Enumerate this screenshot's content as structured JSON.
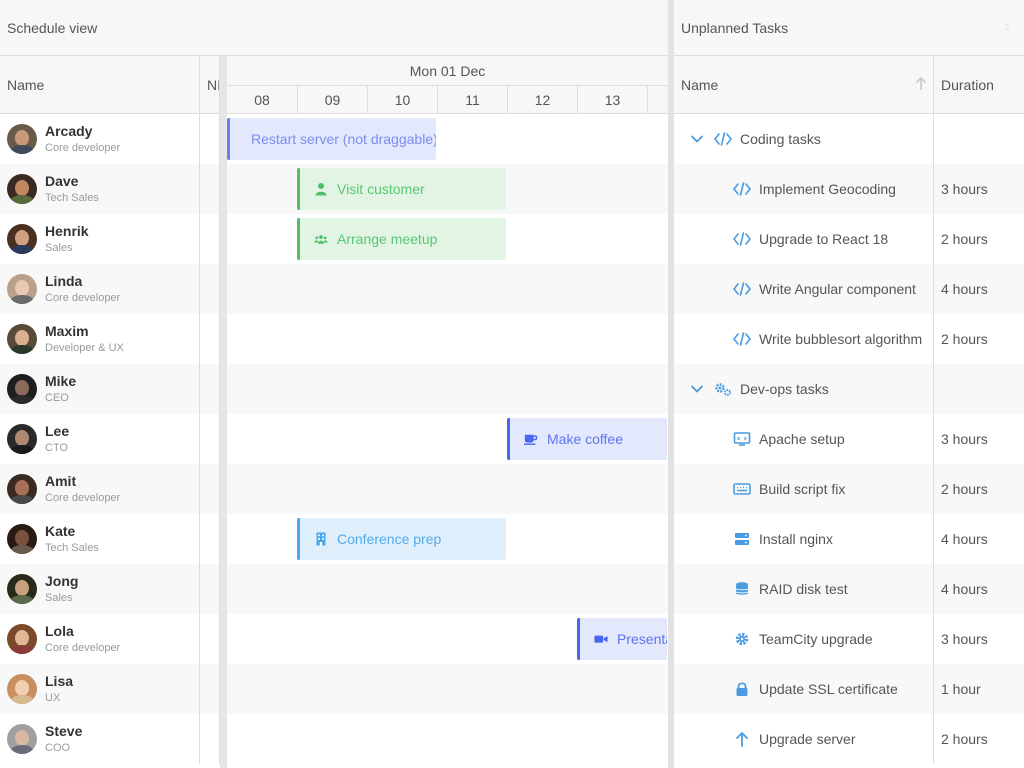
{
  "schedule": {
    "title": "Schedule view",
    "resource_column": "Name",
    "nl_column": "NI",
    "date": "Mon 01 Dec",
    "hours": [
      "08",
      "09",
      "10",
      "11",
      "12",
      "13"
    ],
    "resources": [
      {
        "name": "Arcady",
        "role": "Core developer"
      },
      {
        "name": "Dave",
        "role": "Tech Sales"
      },
      {
        "name": "Henrik",
        "role": "Sales"
      },
      {
        "name": "Linda",
        "role": "Core developer"
      },
      {
        "name": "Maxim",
        "role": "Developer & UX"
      },
      {
        "name": "Mike",
        "role": "CEO"
      },
      {
        "name": "Lee",
        "role": "CTO"
      },
      {
        "name": "Amit",
        "role": "Core developer"
      },
      {
        "name": "Kate",
        "role": "Tech Sales"
      },
      {
        "name": "Jong",
        "role": "Sales"
      },
      {
        "name": "Lola",
        "role": "Core developer"
      },
      {
        "name": "Lisa",
        "role": "UX"
      },
      {
        "name": "Steve",
        "role": "COO"
      }
    ],
    "events": [
      {
        "resource": 0,
        "name": "Restart server (not draggable)",
        "start": "08:00",
        "end": "11:00",
        "icon": "",
        "color": "#6b7ff0",
        "bg": "#e4e8fc",
        "text": "#7a8ef0"
      },
      {
        "resource": 1,
        "name": "Visit customer",
        "start": "09:00",
        "end": "12:00",
        "icon": "user-icon",
        "color": "#4fc068",
        "bg": "#e2f5e5",
        "text": "#5bc572"
      },
      {
        "resource": 2,
        "name": "Arrange meetup",
        "start": "09:00",
        "end": "12:00",
        "icon": "users-icon",
        "color": "#4fc068",
        "bg": "#e2f5e5",
        "text": "#5bc572"
      },
      {
        "resource": 6,
        "name": "Make coffee",
        "start": "12:00",
        "end": "14:30",
        "icon": "coffee-icon",
        "color": "#4a66f0",
        "bg": "#e4e8fc",
        "text": "#5c76ee"
      },
      {
        "resource": 8,
        "name": "Conference prep",
        "start": "09:00",
        "end": "12:00",
        "icon": "building-icon",
        "color": "#4aa8ea",
        "bg": "#dff0fc",
        "text": "#52aaea"
      },
      {
        "resource": 10,
        "name": "Presentation",
        "start": "13:00",
        "end": "15:00",
        "icon": "video-icon",
        "color": "#4a66f0",
        "bg": "#e4e8fc",
        "text": "#5c76ee"
      }
    ]
  },
  "unplanned": {
    "title": "Unplanned Tasks",
    "name_column": "Name",
    "duration_column": "Duration",
    "groups": [
      {
        "name": "Coding tasks",
        "icon": "code-icon",
        "tasks": [
          {
            "name": "Implement Geocoding",
            "duration": "3 hours",
            "icon": "code-icon"
          },
          {
            "name": "Upgrade to React 18",
            "duration": "2 hours",
            "icon": "code-icon"
          },
          {
            "name": "Write Angular component",
            "duration": "4 hours",
            "icon": "code-icon"
          },
          {
            "name": "Write bubblesort algorithm",
            "duration": "2 hours",
            "icon": "code-icon"
          }
        ]
      },
      {
        "name": "Dev-ops tasks",
        "icon": "cogs-icon",
        "tasks": [
          {
            "name": "Apache setup",
            "duration": "3 hours",
            "icon": "monitor-icon"
          },
          {
            "name": "Build script fix",
            "duration": "2 hours",
            "icon": "keyboard-icon"
          },
          {
            "name": "Install nginx",
            "duration": "4 hours",
            "icon": "server-icon"
          },
          {
            "name": "RAID disk test",
            "duration": "4 hours",
            "icon": "database-icon"
          },
          {
            "name": "TeamCity upgrade",
            "duration": "3 hours",
            "icon": "gear-icon"
          },
          {
            "name": "Update SSL certificate",
            "duration": "1 hour",
            "icon": "lock-icon"
          },
          {
            "name": "Upgrade server",
            "duration": "2 hours",
            "icon": "arrow-up-icon"
          }
        ]
      }
    ]
  },
  "colors": {
    "accent": "#4a9be0",
    "header_bg": "#f7f7f7",
    "border": "#dddddd"
  }
}
